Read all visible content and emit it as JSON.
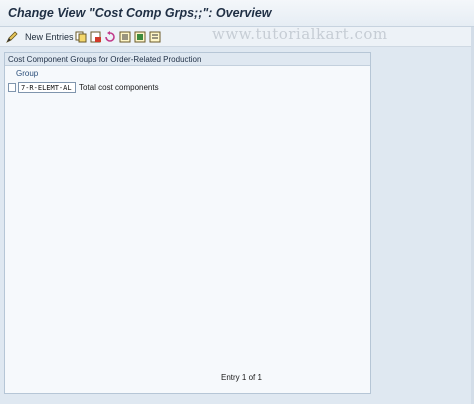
{
  "window": {
    "title": "Change View \"Cost Comp Grps;;\": Overview"
  },
  "toolbar": {
    "new_entries_label": "New Entries",
    "icons": [
      "pencil-glasses-icon",
      "copy-icon",
      "delete-icon",
      "undo-icon",
      "select-all-icon",
      "select-block-icon",
      "deselect-all-icon"
    ]
  },
  "watermark": "www.tutorialkart.com",
  "panel": {
    "title": "Cost Component Groups for Order-Related Production",
    "column_header": "Group",
    "rows": [
      {
        "key": "7-R-ELEMT-AL",
        "description": "Total cost components"
      }
    ],
    "entry_info": "Entry 1 of 1"
  },
  "colors": {
    "background": "#dfe8f1",
    "panel": "#f6f9fc",
    "header_text": "#2b4f7a"
  }
}
